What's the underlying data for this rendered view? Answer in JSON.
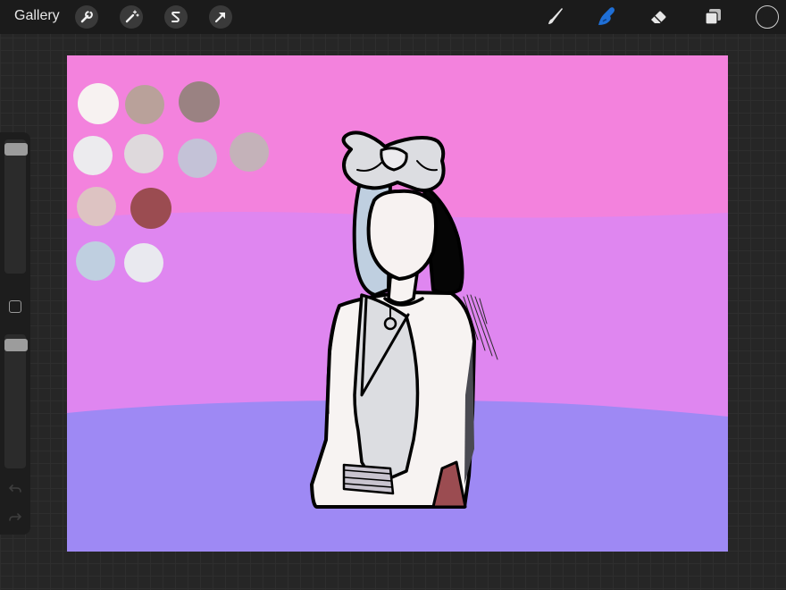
{
  "toolbar": {
    "gallery_label": "Gallery",
    "left_tools": [
      {
        "name": "actions",
        "icon": "wrench-icon"
      },
      {
        "name": "adjustments",
        "icon": "magic-wand-icon"
      },
      {
        "name": "selection",
        "icon": "selection-s-icon"
      },
      {
        "name": "transform",
        "icon": "arrow-cursor-icon"
      }
    ],
    "right_tools": [
      {
        "name": "brush",
        "icon": "brush-icon",
        "active": false
      },
      {
        "name": "smudge",
        "icon": "smudge-finger-icon",
        "active": true
      },
      {
        "name": "eraser",
        "icon": "eraser-icon",
        "active": false
      },
      {
        "name": "layers",
        "icon": "layers-icon",
        "active": false
      }
    ],
    "active_color": "#1d1d1d",
    "active_tool_color": "#1f6fd6"
  },
  "sidebar": {
    "brush_size_level": 0.97,
    "opacity_level": 0.97,
    "modify_icon": "square-modify-icon",
    "undo_icon": "undo-icon",
    "redo_icon": "redo-icon"
  },
  "canvas": {
    "background_colors": {
      "top": "#f282de",
      "middle": "#e086f0",
      "bottom": "#9d87f2"
    },
    "palette_swatches": [
      "#f7f2f1",
      "#b9a19a",
      "#9a8282",
      "#ecebee",
      "#ded9dc",
      "#c4c2d7",
      "#c4b2b9",
      "#ddc3c2",
      "#9b4c51",
      "#bfcfe0",
      "#e9e9ef"
    ]
  }
}
